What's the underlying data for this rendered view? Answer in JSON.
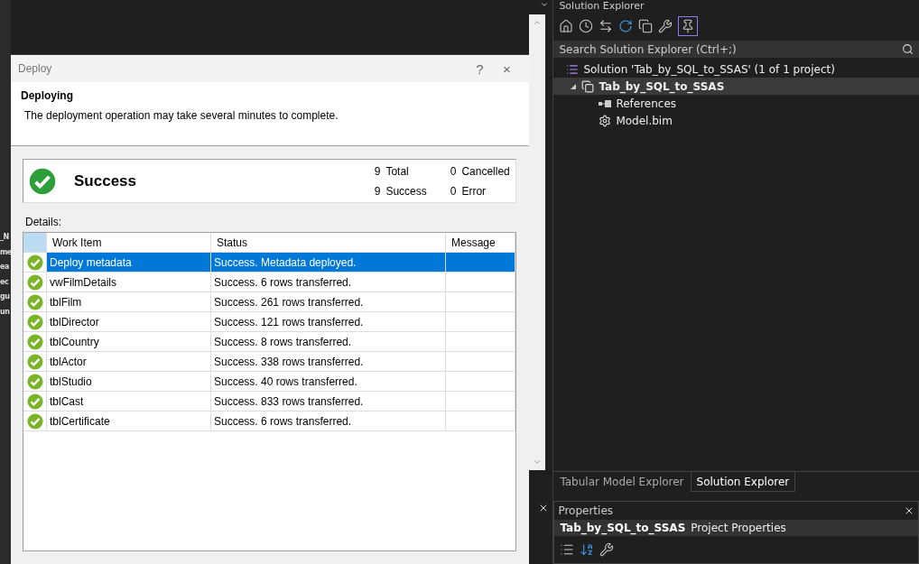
{
  "background_fragments": [
    "_N",
    "me",
    "ea",
    "ec",
    "gu",
    "un"
  ],
  "dialog": {
    "title": "Deploy",
    "help": "?",
    "close": "×",
    "heading": "Deploying",
    "description": "The deployment operation may take several minutes to complete.",
    "summary": {
      "status": "Success",
      "counts": [
        {
          "value": "9",
          "label": "Total"
        },
        {
          "value": "0",
          "label": "Cancelled"
        },
        {
          "value": "9",
          "label": "Success"
        },
        {
          "value": "0",
          "label": "Error"
        }
      ]
    },
    "details_label": "Details:",
    "table": {
      "columns": [
        "Work Item",
        "Status",
        "Message"
      ],
      "rows": [
        {
          "work_item": "Deploy metadata",
          "status": "Success. Metadata deployed.",
          "selected": true
        },
        {
          "work_item": "vwFilmDetails",
          "status": "Success. 6 rows transferred.",
          "selected": false
        },
        {
          "work_item": "tblFilm",
          "status": "Success. 261 rows transferred.",
          "selected": false
        },
        {
          "work_item": "tblDirector",
          "status": "Success. 121 rows transferred.",
          "selected": false
        },
        {
          "work_item": "tblCountry",
          "status": "Success. 8 rows transferred.",
          "selected": false
        },
        {
          "work_item": "tblActor",
          "status": "Success. 338 rows transferred.",
          "selected": false
        },
        {
          "work_item": "tblStudio",
          "status": "Success. 40 rows transferred.",
          "selected": false
        },
        {
          "work_item": "tblCast",
          "status": "Success. 833 rows transferred.",
          "selected": false
        },
        {
          "work_item": "tblCertificate",
          "status": "Success. 6 rows transferred.",
          "selected": false
        }
      ]
    }
  },
  "solution_explorer": {
    "title": "Solution Explorer",
    "search": {
      "placeholder": "Search Solution Explorer (Ctrl+;)"
    },
    "tree": [
      {
        "label": "Solution 'Tab_by_SQL_to_SSAS' (1 of 1 project)",
        "kind": "solution",
        "children": [
          {
            "label": "Tab_by_SQL_to_SSAS",
            "kind": "project",
            "expanded": true,
            "children": [
              {
                "label": "References",
                "kind": "references"
              },
              {
                "label": "Model.bim",
                "kind": "model"
              }
            ]
          }
        ]
      }
    ],
    "tabs": [
      {
        "label": "Tabular Model Explorer",
        "selected": false
      },
      {
        "label": "Solution Explorer",
        "selected": true
      }
    ]
  },
  "properties": {
    "title": "Properties",
    "object_name": "Tab_by_SQL_to_SSAS",
    "object_type": "Project Properties"
  }
}
